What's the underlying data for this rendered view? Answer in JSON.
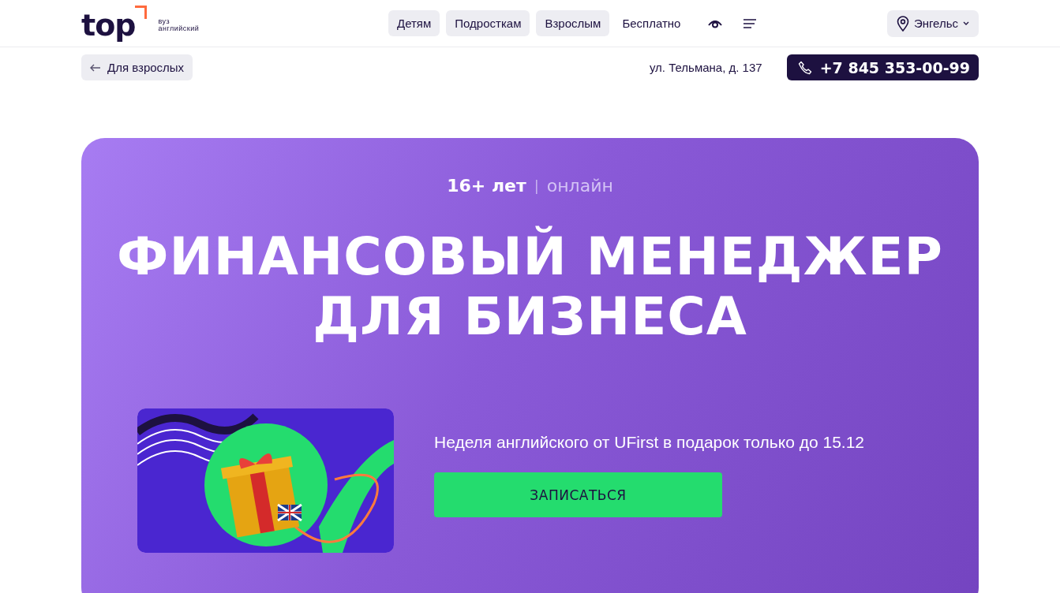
{
  "header": {
    "logo": {
      "wordmark": "top",
      "subtitle_1": "вуз",
      "subtitle_2": "английский"
    },
    "nav": [
      {
        "label": "Детям",
        "kind": "pill"
      },
      {
        "label": "Подросткам",
        "kind": "pill"
      },
      {
        "label": "Взрослым",
        "kind": "pill"
      },
      {
        "label": "Бесплатно",
        "kind": "plain"
      }
    ],
    "city": "Энгельс"
  },
  "subbar": {
    "back_link": "Для взрослых",
    "address": "ул. Тельмана, д. 137",
    "phone": "+7 845 353-00-99"
  },
  "hero": {
    "age": "16+ лет",
    "separator": "|",
    "format": "онлайн",
    "title_line_1": "ФИНАНСОВЫЙ МЕНЕДЖЕР",
    "title_line_2": "ДЛЯ БИЗНЕСА",
    "promo_text": "Неделя английского от UFirst в подарок только до 15.12",
    "cta": "ЗАПИСАТЬСЯ"
  }
}
